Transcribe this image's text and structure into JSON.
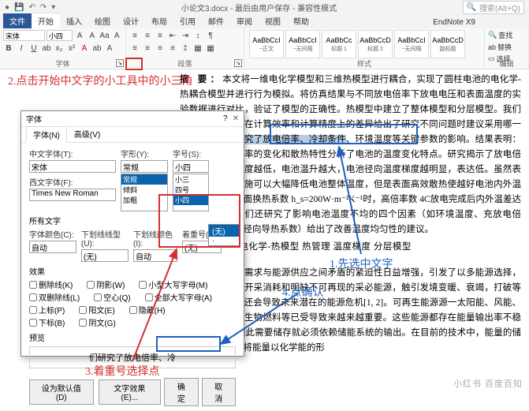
{
  "titlebar": {
    "doc_name": "小论文3.docx - 最后由用户保存 - 兼容性模式",
    "search_placeholder": "搜索(Alt+Q)"
  },
  "tabs": {
    "file": "文件",
    "home": "开始",
    "insert": "插入",
    "draw": "绘图",
    "design": "设计",
    "layout": "布局",
    "references": "引用",
    "mailings": "邮件",
    "review": "审阅",
    "view": "视图",
    "help": "帮助",
    "endnote": "EndNote X9"
  },
  "ribbon": {
    "font_name": "宋体",
    "font_size": "小四",
    "group_font": "字体",
    "group_para": "段落",
    "group_style": "样式",
    "group_edit": "编辑",
    "styles": [
      {
        "preview": "AaBbCcI",
        "name": "~正文"
      },
      {
        "preview": "AaBbCcI",
        "name": "~无间隔"
      },
      {
        "preview": "AaBbCc",
        "name": "标题 1"
      },
      {
        "preview": "AaBbCcD",
        "name": "标题 2"
      },
      {
        "preview": "AaBbCcI",
        "name": "~无间隔"
      },
      {
        "preview": "AaBbCcD",
        "name": "副标题"
      }
    ],
    "edit_find": "查找",
    "edit_replace": "替换",
    "edit_select": "选择"
  },
  "doc": {
    "abstract_label": "摘 要：",
    "p1": "本文将一维电化学模型和三维热模型进行耦合，实现了圆柱电池的电化学-热耦合模型并进行行为模拟。将仿真结果与不同放电倍率下放电电压和表面温度的实验数据进行对比，验证了模型的正确性。热模型中建立了整体模型和分层模型。我们比较这两种模型在计算效率和计算精度上的差异给出了研究不同问题时建议采用哪一种模型。",
    "sel": "我们研究了放电倍率、冷却条件",
    "p1b": "、环境温度等关键参数的影响。结果表明：放电过程中生热率的变化和散热特性分析了电池的温度变化特点。研究揭示了放电倍率越高，环境温度越低，电池温升越大，电池径向温度梯度越明显，表达低。虽然表面良好的散热措施可以大幅降低电池整体温度，但是表面高效散热使越好电池内外温差越大，对于表面换热系数 h_s=200W·m⁻²K⁻¹时，高倍率数 4C放电完成后内外温差达到 7℃左右。我们还研究了影响电池温度不均的四个因素（如环境温度、充放电倍率、径向尺寸、径向导热系数）给出了改善温度均匀性的建议。",
    "kw_label": "关键词",
    "kw": "子电池 电化学-热模型 热管理 温度梯度 分层模型",
    "p2": "日益增加的能源需求与能源供应之间矛盾的紧迫性日益增强，引发了以多能源选择，化石燃料的大量开采消耗和明缺不可再现的采必能源，触引发境变暖、衰竭，打破等环境问题，而且还会导致未来潜在的能源危机[1, 2]。可再生能源源一太阳能、风能、水能、地热能、生物燃料等已受导致来越来越重要。这些能源都存在能量输出率不稳定的问题[3]，因此需要储存就必须依赖储能系统的输出。在目前的技术中，能量的储存主要通过电池将能量以化学能的形"
  },
  "dialog": {
    "title": "字体",
    "tab_font": "字体(N)",
    "tab_adv": "高级(V)",
    "lbl_cfont": "中文字体(T):",
    "val_cfont": "宋体",
    "lbl_style": "字形(Y):",
    "val_style": "常规",
    "style_opts": [
      "常规",
      "倾斜",
      "加粗"
    ],
    "lbl_size": "字号(S):",
    "val_size": "小四",
    "size_opts": [
      "小三",
      "四号",
      "小四"
    ],
    "lbl_wfont": "西文字体(F):",
    "val_wfont": "Times New Roman",
    "section_all": "所有文字",
    "lbl_color": "字体颜色(C):",
    "val_color": "自动",
    "lbl_underline": "下划线线型(U):",
    "val_underline": "(无)",
    "lbl_ulcolor": "下划线颜色(I):",
    "val_ulcolor": "自动",
    "lbl_emphasis": "着重号(:)",
    "val_emphasis": "(无)",
    "emph_opts": [
      "(无)",
      "·"
    ],
    "section_fx": "效果",
    "fx": {
      "strike": "删除线(K)",
      "dstrike": "双删除线(L)",
      "super": "上标(P)",
      "sub": "下标(B)",
      "shadow": "阴影(W)",
      "outline": "空心(Q)",
      "emboss": "阳文(E)",
      "engrave": "阴文(G)",
      "smallcaps": "小型大写字母(M)",
      "allcaps": "全部大写字母(A)",
      "hidden": "隐藏(H)"
    },
    "section_preview": "预览",
    "preview_text": "们研究了放电倍率、冷",
    "btn_default": "设为默认值(D)",
    "btn_textfx": "文字效果(E)...",
    "btn_ok": "确定",
    "btn_cancel": "取消"
  },
  "annotations": {
    "a1": "1.先选中文字",
    "a2": "2.点击开始中文字的小工具中的小三角",
    "a3": "3.着重号选择点",
    "a4": "4.点确认"
  },
  "watermark": "小红书 百度百知"
}
